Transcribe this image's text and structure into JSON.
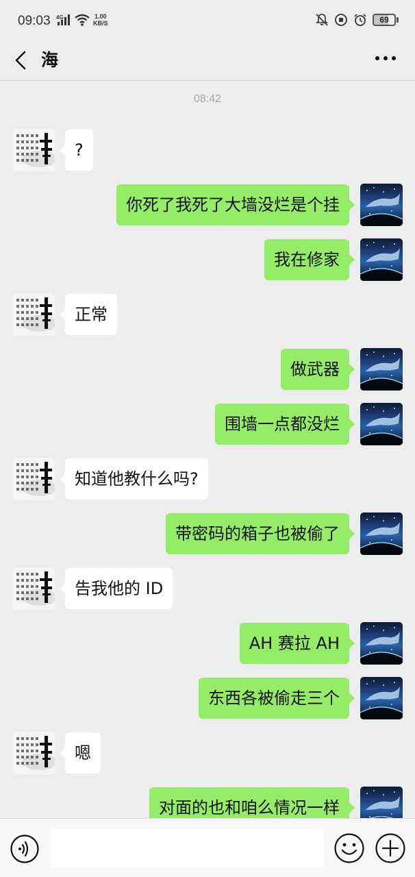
{
  "status_bar": {
    "time": "09:03",
    "network": "4G",
    "speed_value": "1.00",
    "speed_unit": "KB/S",
    "battery": "69",
    "battery_level": 0.69,
    "icons": [
      "mute-bell-icon",
      "data-saver-icon",
      "alarm-icon",
      "battery-icon"
    ]
  },
  "header": {
    "title": "海",
    "back_icon": "chevron-left-icon",
    "more_icon": "more-dots-icon"
  },
  "chat": {
    "timestamp": "08:42",
    "messages": [
      {
        "side": "in",
        "text": "?"
      },
      {
        "side": "out",
        "text": "你死了我死了大墙没烂是个挂"
      },
      {
        "side": "out",
        "text": "我在修家"
      },
      {
        "side": "in",
        "text": "正常"
      },
      {
        "side": "out",
        "text": "做武器"
      },
      {
        "side": "out",
        "text": "围墙一点都没烂"
      },
      {
        "side": "in",
        "text": "知道他教什么吗?"
      },
      {
        "side": "out",
        "text": "带密码的箱子也被偷了"
      },
      {
        "side": "in",
        "text": "告我他的 ID"
      },
      {
        "side": "out",
        "text": "AH 赛拉 AH"
      },
      {
        "side": "out",
        "text": "东西各被偷走三个"
      },
      {
        "side": "in",
        "text": "嗯"
      },
      {
        "side": "out",
        "text": "对面的也和咱么情况一样"
      }
    ]
  },
  "input_bar": {
    "voice_icon": "voice-icon",
    "emoji_icon": "emoji-icon",
    "plus_icon": "plus-icon",
    "text_value": ""
  },
  "colors": {
    "background": "#ededed",
    "outgoing_bubble": "#95ec69",
    "incoming_bubble": "#ffffff",
    "timestamp": "#a8a8a8"
  }
}
